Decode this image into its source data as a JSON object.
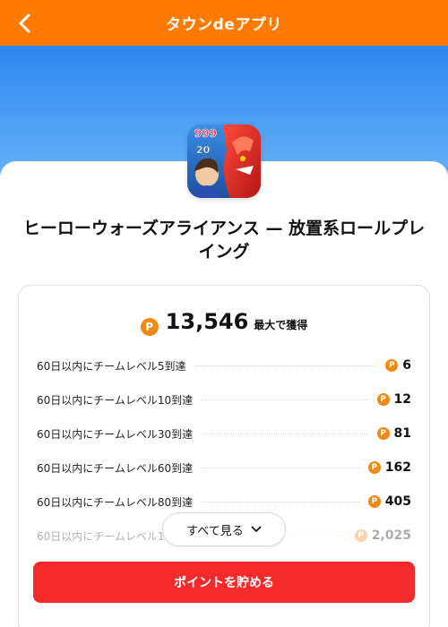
{
  "header": {
    "title": "タウンdeアプリ",
    "back_icon": "chevron-left-icon"
  },
  "app": {
    "name": "ヒーローウォーズアライアンス — 放置系ロールプレイング",
    "icon_texts": {
      "top": "999",
      "mid": "20"
    }
  },
  "rewards": {
    "total_points": "13,546",
    "total_suffix": "最大で獲得",
    "coin_glyph": "P",
    "items": [
      {
        "label": "60日以内にチームレベル5到達",
        "points": "6"
      },
      {
        "label": "60日以内にチームレベル10到達",
        "points": "12"
      },
      {
        "label": "60日以内にチームレベル30到達",
        "points": "81"
      },
      {
        "label": "60日以内にチームレベル60到達",
        "points": "162"
      },
      {
        "label": "60日以内にチームレベル80到達",
        "points": "405"
      },
      {
        "label": "60日以内にチームレベル1",
        "points": "2,025"
      }
    ],
    "see_all_label": "すべて見る"
  },
  "cta": {
    "label": "ポイントを貯める"
  },
  "colors": {
    "header": "#ff7a00",
    "coin": "#f08a12",
    "cta": "#f52a2a",
    "hero_top": "#2f86f0",
    "hero_bottom": "#6bb4f7"
  }
}
